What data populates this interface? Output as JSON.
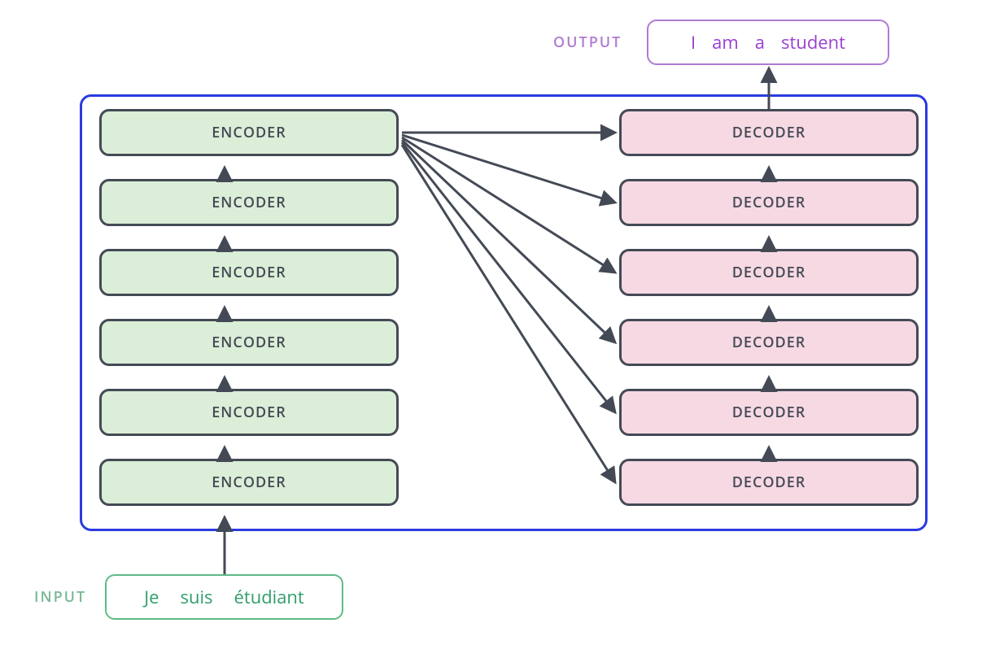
{
  "encoder": {
    "label": "ENCODER",
    "count": 6
  },
  "decoder": {
    "label": "DECODER",
    "count": 6
  },
  "input": {
    "label": "INPUT",
    "tokens": [
      "Je",
      "suis",
      "étudiant"
    ]
  },
  "output": {
    "label": "OUTPUT",
    "tokens": [
      "I",
      "am",
      "a",
      "student"
    ]
  },
  "colors": {
    "encoder_fill": "#dbeed8",
    "decoder_fill": "#f7d9e3",
    "block_border": "#444a55",
    "outer_border": "#2b3be0",
    "input_accent": "#2f9e6a",
    "output_accent": "#9a3ed2"
  }
}
